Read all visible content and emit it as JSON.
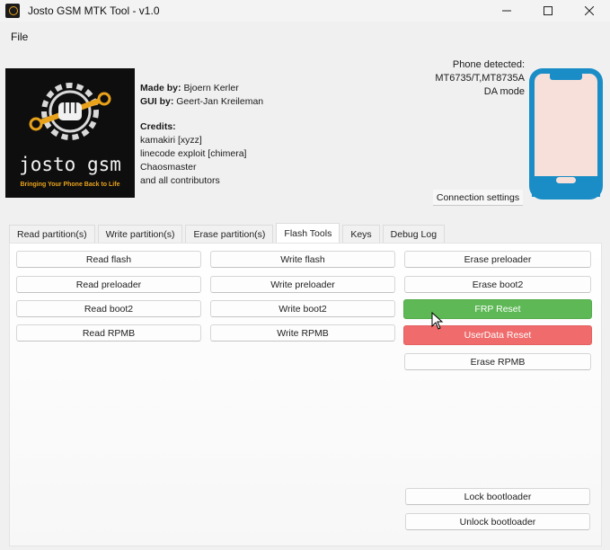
{
  "window": {
    "title": "Josto GSM MTK Tool - v1.0",
    "controls": {
      "minimize": "—",
      "maximize": "☐",
      "close": "✕"
    }
  },
  "menu": {
    "file": "File"
  },
  "logo": {
    "title": "josto gsm",
    "tagline": "Bringing Your Phone Back to Life"
  },
  "credits": {
    "made_by_label": "Made by:",
    "made_by": "Bjoern Kerler",
    "gui_by_label": "GUI by:",
    "gui_by": "Geert-Jan Kreileman",
    "credits_label": "Credits:",
    "list": [
      "kamakiri [xyzz]",
      "linecode exploit [chimera]",
      "Chaosmaster",
      "and all contributors"
    ]
  },
  "phone": {
    "detected_label": "Phone detected:",
    "model": "MT6735/T,MT8735A",
    "mode": "DA mode",
    "connection_settings": "Connection settings",
    "colors": {
      "frame": "#1a8dc7",
      "screen": "#f7e0da"
    }
  },
  "tabs": [
    {
      "label": "Read partition(s)"
    },
    {
      "label": "Write partition(s)"
    },
    {
      "label": "Erase partition(s)"
    },
    {
      "label": "Flash Tools",
      "active": true
    },
    {
      "label": "Keys"
    },
    {
      "label": "Debug Log"
    }
  ],
  "flash_tools": {
    "read_flash": "Read flash",
    "read_preloader": "Read preloader",
    "read_boot2": "Read boot2",
    "read_rpmb": "Read RPMB",
    "write_flash": "Write flash",
    "write_preloader": "Write preloader",
    "write_boot2": "Write boot2",
    "write_rpmb": "Write RPMB",
    "erase_preloader": "Erase preloader",
    "erase_boot2": "Erase boot2",
    "frp_reset": "FRP Reset",
    "userdata_reset": "UserData Reset",
    "erase_rpmb": "Erase RPMB",
    "lock_bootloader": "Lock bootloader",
    "unlock_bootloader": "Unlock bootloader",
    "colors": {
      "frp": "#5db855",
      "userdata": "#f06b6b"
    }
  }
}
